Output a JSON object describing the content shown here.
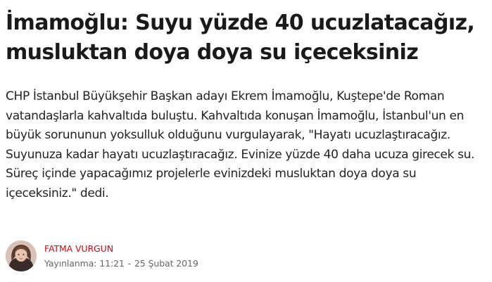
{
  "article": {
    "headline_line1": "İmamoğlu: Suyu yüzde 40 ucuzlatacağız,",
    "headline_line2": "musluktan doya doya su içeceksiniz",
    "summary": "CHP İstanbul Büyükşehir Başkan adayı Ekrem İmamoğlu, Kuştepe'de Roman vatandaşlarla kahvaltıda buluştu. Kahvaltıda konuşan İmamoğlu, İstanbul'un en büyük sorununun yoksulluk olduğunu vurgulayarak, \"Hayatı ucuzlaştıracağız. Suyunuza kadar hayatı ucuzlaştıracağız. Evinize yüzde 40 daha ucuza girecek su. Süreç içinde yapacağımız projelerle evinizdeki musluktan doya doya su içeceksiniz.\" dedi."
  },
  "byline": {
    "author": "FATMA VURGUN",
    "published_label": "Yayınlanma:",
    "time": "11:21",
    "separator": "-",
    "date": "25 Şubat 2019"
  },
  "colors": {
    "author": "#d10a11",
    "meta": "#666666",
    "text": "#222222"
  }
}
